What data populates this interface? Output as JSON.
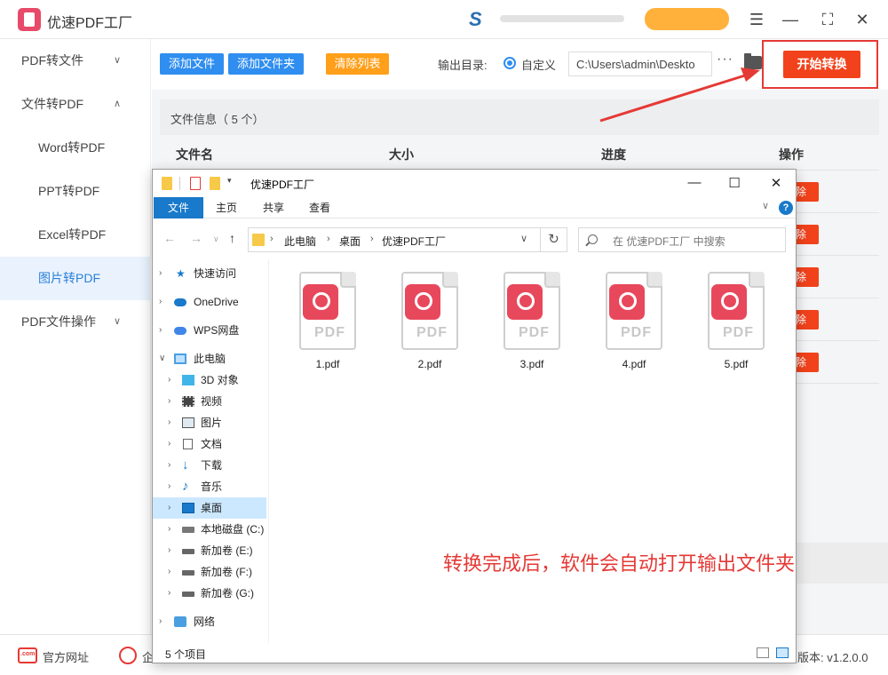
{
  "app": {
    "title": "优速PDF工厂"
  },
  "window_buttons": {
    "menu": "☰",
    "minimize": "—",
    "maximize": "⛶",
    "close": "✕"
  },
  "sidebar": {
    "items": [
      {
        "label": "PDF转文件",
        "chevron": "∨"
      },
      {
        "label": "文件转PDF",
        "chevron": "∧"
      },
      {
        "label": "Word转PDF"
      },
      {
        "label": "PPT转PDF"
      },
      {
        "label": "Excel转PDF"
      },
      {
        "label": "图片转PDF"
      },
      {
        "label": "PDF文件操作",
        "chevron": "∨"
      }
    ]
  },
  "toolbar": {
    "add_file": "添加文件",
    "add_folder": "添加文件夹",
    "clear_list": "清除列表",
    "output_label": "输出目录:",
    "custom_label": "自定义",
    "output_path": "C:\\Users\\admin\\Deskto",
    "more": "···",
    "start": "开始转换"
  },
  "file_table": {
    "info": "文件信息（ 5 个）",
    "headers": {
      "name": "文件名",
      "size": "大小",
      "progress": "进度",
      "action": "操作"
    },
    "delete_label": "除"
  },
  "footer": {
    "website": "官方网址",
    "enterprise": "企",
    "version": "版本: v1.2.0.0"
  },
  "explorer": {
    "title": "优速PDF工厂",
    "ribbon_tabs": [
      "文件",
      "主页",
      "共享",
      "查看"
    ],
    "help": "?",
    "breadcrumb": [
      "此电脑",
      "桌面",
      "优速PDF工厂"
    ],
    "search_placeholder": "在 优速PDF工厂 中搜索",
    "nav_tree": [
      {
        "label": "快速访问",
        "icon": "star-icon"
      },
      {
        "label": "OneDrive",
        "icon": "cloud-icon"
      },
      {
        "label": "WPS网盘",
        "icon": "cloud-icon"
      },
      {
        "label": "此电脑",
        "icon": "computer-icon"
      },
      {
        "label": "3D 对象",
        "icon": "cube-icon"
      },
      {
        "label": "视频",
        "icon": "film-icon"
      },
      {
        "label": "图片",
        "icon": "image-icon"
      },
      {
        "label": "文档",
        "icon": "document-icon"
      },
      {
        "label": "下载",
        "icon": "download-icon"
      },
      {
        "label": "音乐",
        "icon": "music-icon"
      },
      {
        "label": "桌面",
        "icon": "desktop-icon"
      },
      {
        "label": "本地磁盘 (C:)",
        "icon": "drive-icon"
      },
      {
        "label": "新加卷 (E:)",
        "icon": "drive-icon"
      },
      {
        "label": "新加卷 (F:)",
        "icon": "drive-icon"
      },
      {
        "label": "新加卷 (G:)",
        "icon": "drive-icon"
      },
      {
        "label": "网络",
        "icon": "network-icon"
      }
    ],
    "files": [
      "1.pdf",
      "2.pdf",
      "3.pdf",
      "4.pdf",
      "5.pdf"
    ],
    "file_badge_text": "PDF",
    "annotation": "转换完成后，软件会自动打开输出文件夹",
    "status": "5 个项目"
  },
  "colors": {
    "accent_blue": "#2f8ef0",
    "accent_orange": "#ff9f1a",
    "start_red": "#f1421b",
    "annotation_red": "#e53935"
  }
}
